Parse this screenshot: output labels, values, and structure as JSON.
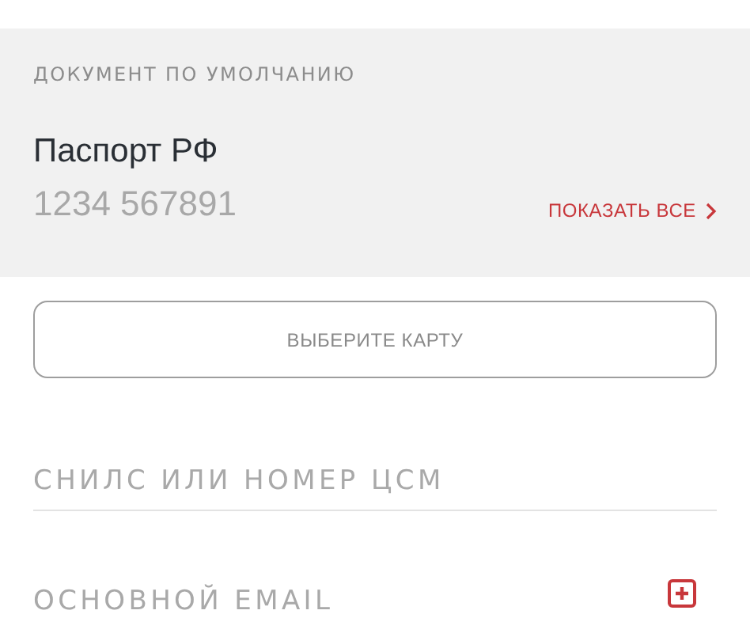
{
  "default_document": {
    "heading": "ДОКУМЕНТ ПО УМОЛЧАНИЮ",
    "name": "Паспорт РФ",
    "number": "1234 567891",
    "show_all": "ПОКАЗАТЬ ВСЕ"
  },
  "card_button": {
    "label": "ВЫБЕРИТЕ КАРТУ"
  },
  "fields": [
    {
      "kind": "text",
      "placeholder": "СНИЛС ИЛИ НОМЕР ЦСМ"
    },
    {
      "kind": "add",
      "placeholder": "ОСНОВНОЙ EMAIL"
    }
  ]
}
